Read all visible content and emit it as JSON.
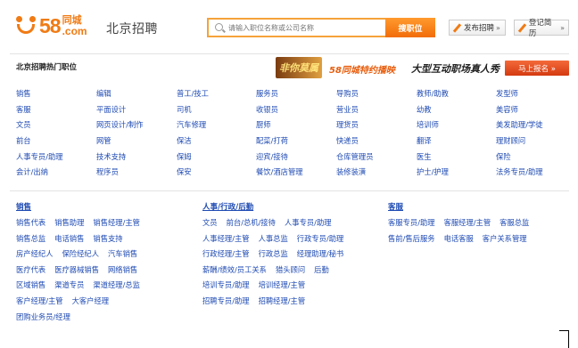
{
  "header": {
    "logo_number": "58",
    "logo_cn": "同城",
    "logo_com": ".com",
    "site_title": "北京招聘",
    "search_placeholder": "请输入职位名称或公司名称",
    "search_button": "搜职位",
    "publish_button": "发布招聘",
    "login_button": "登记简历",
    "chevron": "»"
  },
  "hot": {
    "title": "北京招聘热门职位",
    "banner_logo": "非你莫属",
    "banner_text1": "58同城特约播映",
    "banner_text2": "大型互动职场真人秀",
    "banner_button": "马上报名 »",
    "rows": [
      [
        "销售",
        "编辑",
        "普工/技工",
        "服务员",
        "导购员",
        "教师/助教",
        "发型师"
      ],
      [
        "客服",
        "平面设计",
        "司机",
        "收银员",
        "营业员",
        "幼教",
        "美容师"
      ],
      [
        "文员",
        "网页设计/制作",
        "汽车修理",
        "厨师",
        "理货员",
        "培训师",
        "美发助理/学徒"
      ],
      [
        "前台",
        "网管",
        "保洁",
        "配菜/打荷",
        "快递员",
        "翻译",
        "理财顾问"
      ],
      [
        "人事专员/助理",
        "技术支持",
        "保姆",
        "迎宾/接待",
        "仓库管理员",
        "医生",
        "保险"
      ],
      [
        "会计/出纳",
        "程序员",
        "保安",
        "餐饮/酒店管理",
        "装修装潢",
        "护士/护理",
        "法务专员/助理"
      ]
    ]
  },
  "categories": [
    {
      "title": "销售",
      "rows": [
        [
          "销售代表",
          "销售助理",
          "销售经理/主管"
        ],
        [
          "销售总监",
          "电话销售",
          "销售支持"
        ],
        [
          "房产经纪人",
          "保险经纪人",
          "汽车销售"
        ],
        [
          "医疗代表",
          "医疗器械销售",
          "网络销售"
        ],
        [
          "区域销售",
          "渠道专员",
          "渠道经理/总监"
        ],
        [
          "客户经理/主管",
          "大客户经理"
        ],
        [
          "团购业务员/经理"
        ]
      ]
    },
    {
      "title": "人事/行政/后勤",
      "rows": [
        [
          "文员",
          "前台/总机/接待",
          "人事专员/助理"
        ],
        [
          "人事经理/主管",
          "人事总监",
          "行政专员/助理"
        ],
        [
          "行政经理/主管",
          "行政总监",
          "经理助理/秘书"
        ],
        [
          "薪酬/绩效/员工关系",
          "猎头顾问",
          "后勤"
        ],
        [
          "培训专员/助理",
          "培训经理/主管"
        ],
        [
          "招聘专员/助理",
          "招聘经理/主管"
        ]
      ]
    },
    {
      "title": "客服",
      "rows": [
        [
          "客服专员/助理",
          "客服经理/主管",
          "客服总监"
        ],
        [
          "售前/售后服务",
          "电话客服",
          "客户关系管理"
        ]
      ]
    }
  ]
}
